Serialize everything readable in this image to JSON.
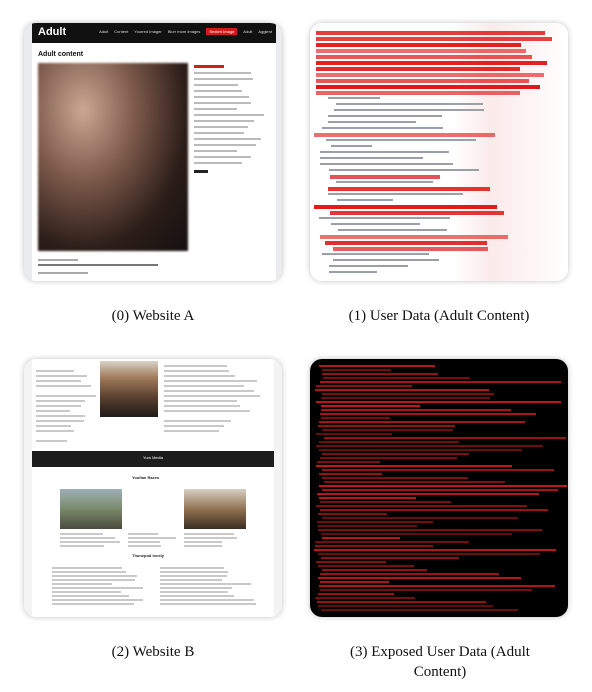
{
  "panels": [
    {
      "caption": "(0) Website A",
      "site": {
        "logo": "Adult",
        "nav": [
          "Adult",
          "Content",
          "Yourred Imager",
          "Blurr more images",
          "Sextert Image",
          "Adult",
          "Aggient"
        ],
        "title": "Adult content"
      }
    },
    {
      "caption": "(1) User Data (Adult Content)"
    },
    {
      "caption": "(2) Website B",
      "site": {
        "band_label": "Yurs Media",
        "section_title": "Youfian Races",
        "section_title_2": "Thonepod lonely"
      }
    },
    {
      "caption": "(3) Exposed User Data (Adult Content)"
    }
  ],
  "colors": {
    "accent_red": "#d01b1b",
    "dark": "#111111"
  }
}
